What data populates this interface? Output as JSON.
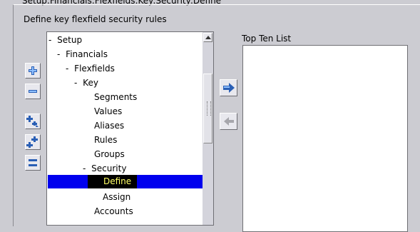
{
  "path_title": "Setup:Financials:Flexfields:Key:Security:Define",
  "subtitle": "Define key flexfield security rules",
  "tree": {
    "items": [
      {
        "label": "Setup",
        "prefix": "-"
      },
      {
        "label": "Financials",
        "prefix": "-"
      },
      {
        "label": "Flexfields",
        "prefix": "-"
      },
      {
        "label": "Key",
        "prefix": "-"
      },
      {
        "label": "Segments",
        "prefix": ""
      },
      {
        "label": "Values",
        "prefix": ""
      },
      {
        "label": "Aliases",
        "prefix": ""
      },
      {
        "label": "Rules",
        "prefix": ""
      },
      {
        "label": "Groups",
        "prefix": ""
      },
      {
        "label": "Security",
        "prefix": "-"
      },
      {
        "label": "Define",
        "prefix": "",
        "selected": true
      },
      {
        "label": "Assign",
        "prefix": ""
      },
      {
        "label": "Accounts",
        "prefix": ""
      }
    ]
  },
  "left_buttons": [
    {
      "name": "expand-button",
      "icon": "plus-icon"
    },
    {
      "name": "collapse-button",
      "icon": "minus-icon"
    },
    {
      "name": "expand-branch-button",
      "icon": "expand-branch-icon"
    },
    {
      "name": "expand-all-button",
      "icon": "expand-all-icon"
    },
    {
      "name": "collapse-all-button",
      "icon": "collapse-all-icon"
    }
  ],
  "top_ten": {
    "title": "Top Ten List"
  },
  "colors": {
    "selection_bg": "#0000ee",
    "selection_text": "#ffff66",
    "window_bg": "#ccccd2"
  }
}
